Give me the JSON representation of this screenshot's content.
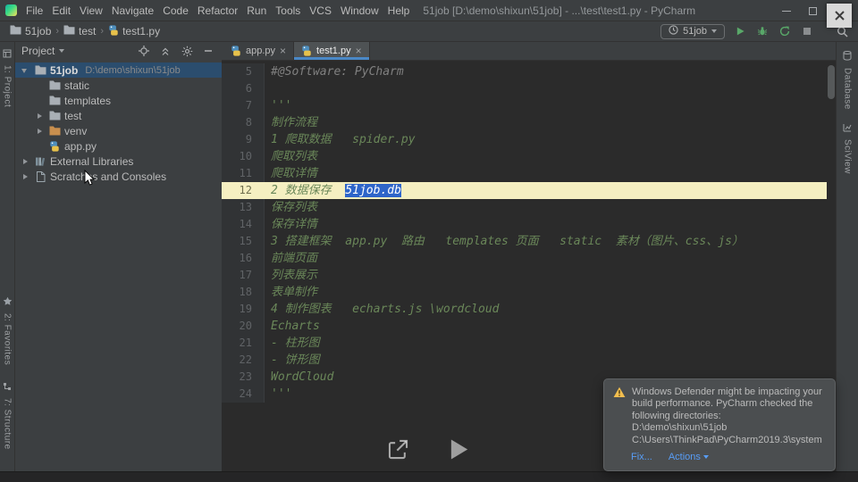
{
  "colors": {
    "panel": "#3C3F41",
    "editor_bg": "#2B2B2B",
    "border": "#323232",
    "text": "#BBBBBB",
    "dim_text": "#8C8C8C",
    "accent": "#4A88C7",
    "run_green": "#59A869",
    "link": "#589DF6",
    "docstring": "#6A8759",
    "comment": "#808080",
    "caret_line": "#F5EFC1",
    "selection": "#2E65C9",
    "tree_selection": "#2B4D6E",
    "warning": "#F2BE4F"
  },
  "titlebar": {
    "menus": [
      "File",
      "Edit",
      "View",
      "Navigate",
      "Code",
      "Refactor",
      "Run",
      "Tools",
      "VCS",
      "Window",
      "Help"
    ],
    "title": "51job [D:\\demo\\shixun\\51job] - ...\\test\\test1.py - PyCharm"
  },
  "navbar": {
    "breadcrumbs": [
      {
        "label": "51job",
        "icon": "folder"
      },
      {
        "label": "test",
        "icon": "folder"
      },
      {
        "label": "test1.py",
        "icon": "python"
      }
    ],
    "run_config": "51job"
  },
  "left_strip": {
    "top": [
      {
        "icon": "project",
        "label": "1: Project"
      }
    ],
    "bottom": [
      {
        "icon": "star",
        "label": "2: Favorites"
      },
      {
        "icon": "structure",
        "label": "7: Structure"
      }
    ]
  },
  "right_strip": [
    {
      "icon": "database",
      "label": "Database"
    },
    {
      "icon": "sciview",
      "label": "SciView"
    }
  ],
  "project_panel": {
    "header": "Project",
    "tree": [
      {
        "label": "51job",
        "path": "D:\\demo\\shixun\\51job",
        "icon": "folder",
        "chevron": "down",
        "indent": 0,
        "selected": true,
        "bold": true
      },
      {
        "label": "static",
        "icon": "folder",
        "indent": 1
      },
      {
        "label": "templates",
        "icon": "folder",
        "indent": 1
      },
      {
        "label": "test",
        "icon": "folder",
        "chevron": "right",
        "indent": 1
      },
      {
        "label": "venv",
        "icon": "folder-excluded",
        "chevron": "right",
        "indent": 1
      },
      {
        "label": "app.py",
        "icon": "python",
        "indent": 1
      },
      {
        "label": "External Libraries",
        "icon": "libraries",
        "chevron": "right",
        "indent": 0
      },
      {
        "label": "Scratches and Consoles",
        "icon": "scratches",
        "chevron": "right",
        "indent": 0
      }
    ]
  },
  "tabs": [
    {
      "label": "app.py",
      "icon": "python",
      "close": "×"
    },
    {
      "label": "test1.py",
      "icon": "python",
      "close": "×",
      "active": true
    }
  ],
  "editor": {
    "lines": [
      {
        "num": 5,
        "text": "#@Software: PyCharm",
        "style": "comment"
      },
      {
        "num": 6,
        "text": ""
      },
      {
        "num": 7,
        "text": "'''"
      },
      {
        "num": 8,
        "text": "制作流程"
      },
      {
        "num": 9,
        "text": "1 爬取数据   spider.py"
      },
      {
        "num": 10,
        "text": "爬取列表"
      },
      {
        "num": 11,
        "text": "爬取详情"
      },
      {
        "num": 12,
        "pre": "2 数据保存  ",
        "sel": "51job.db",
        "post": "",
        "caretline": true
      },
      {
        "num": 13,
        "text": "保存列表"
      },
      {
        "num": 14,
        "text": "保存详情"
      },
      {
        "num": 15,
        "text": "3 搭建框架  app.py  路由   templates 页面   static  素材（图片、css、js）"
      },
      {
        "num": 16,
        "text": "前端页面"
      },
      {
        "num": 17,
        "text": "列表展示"
      },
      {
        "num": 18,
        "text": "表单制作"
      },
      {
        "num": 19,
        "text": "4 制作图表   echarts.js \\wordcloud"
      },
      {
        "num": 20,
        "text": "Echarts"
      },
      {
        "num": 21,
        "text": "- 柱形图"
      },
      {
        "num": 22,
        "text": "- 饼形图"
      },
      {
        "num": 23,
        "text": "WordCloud"
      },
      {
        "num": 24,
        "text": "'''"
      }
    ]
  },
  "notification": {
    "message": "Windows Defender might be impacting your build performance. PyCharm checked the following directories:",
    "paths": [
      "D:\\demo\\shixun\\51job",
      "C:\\Users\\ThinkPad\\PyCharm2019.3\\system"
    ],
    "fix_label": "Fix...",
    "actions_label": "Actions"
  }
}
